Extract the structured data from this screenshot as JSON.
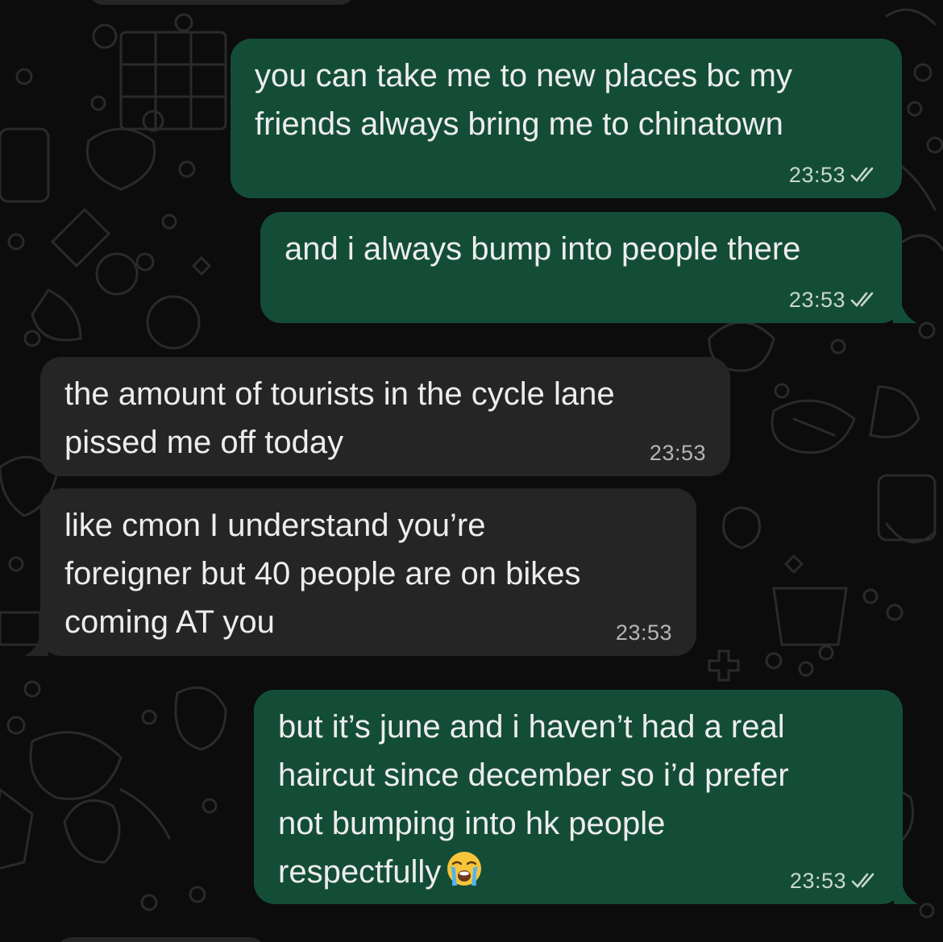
{
  "colors": {
    "background": "#0c0c0c",
    "outgoing_bubble": "#144d37",
    "incoming_bubble": "#252525",
    "text": "#ededed",
    "read_ticks": "#c9d7cf"
  },
  "messages": [
    {
      "direction": "outgoing",
      "text": "you can take me to new places bc my\nfriends always bring me to chinatown",
      "time": "23:53",
      "status": "read"
    },
    {
      "direction": "outgoing",
      "text": "and i always bump into people there",
      "time": "23:53",
      "status": "read"
    },
    {
      "direction": "incoming",
      "text": "the amount of tourists in the cycle lane\npissed me off today",
      "time": "23:53"
    },
    {
      "direction": "incoming",
      "text": "like cmon I understand you’re\nforeigner but 40 people are on bikes\ncoming AT you",
      "time": "23:53"
    },
    {
      "direction": "outgoing",
      "text": "but it’s june and i haven’t had a real\nhaircut since december so i’d prefer\nnot bumping into hk people\nrespectfully",
      "emoji": "loudly-crying-face",
      "time": "23:53",
      "status": "read"
    }
  ]
}
